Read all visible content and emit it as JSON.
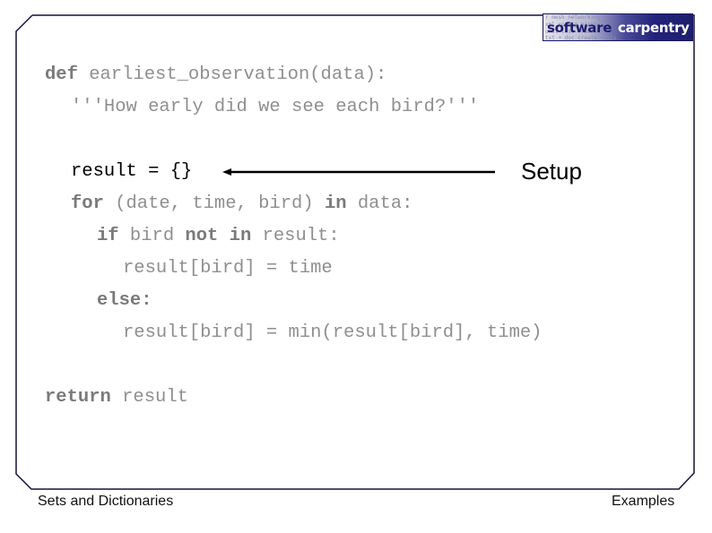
{
  "slide": {
    "logo": {
      "word1": "software",
      "word2": "carpentry",
      "faint_lines": [
        "r mesh networking",
        "xml config parser",
        "unit test framework",
        "txt + doc create tests"
      ]
    },
    "code_lines": [
      {
        "indent": 0,
        "parts": [
          {
            "t": "def",
            "kw": true
          },
          {
            "t": " earliest_observation(data):"
          }
        ]
      },
      {
        "indent": 1,
        "parts": [
          {
            "t": "'''How early did we see each bird?'''"
          }
        ]
      },
      {
        "indent": 1,
        "highlight": true,
        "parts": [
          {
            "t": "result = {}"
          }
        ]
      },
      {
        "indent": 1,
        "parts": [
          {
            "t": "for",
            "kw": true
          },
          {
            "t": " (date, time, bird) "
          },
          {
            "t": "in",
            "kw": true
          },
          {
            "t": " data:"
          }
        ]
      },
      {
        "indent": 2,
        "parts": [
          {
            "t": "if",
            "kw": true
          },
          {
            "t": " bird "
          },
          {
            "t": "not",
            "kw": true
          },
          {
            "t": " "
          },
          {
            "t": "in",
            "kw": true
          },
          {
            "t": " result:"
          }
        ]
      },
      {
        "indent": 3,
        "parts": [
          {
            "t": "result[bird] = time"
          }
        ]
      },
      {
        "indent": 2,
        "parts": [
          {
            "t": "else:",
            "kw": true
          }
        ]
      },
      {
        "indent": 3,
        "parts": [
          {
            "t": "result[bird] = min(result[bird], time)"
          }
        ]
      },
      {
        "indent": 0,
        "parts": [
          {
            "t": "return",
            "kw": true
          },
          {
            "t": " result"
          }
        ]
      }
    ],
    "annotation": "Setup",
    "footer_left": "Sets and Dictionaries",
    "footer_right": "Examples"
  },
  "colors": {
    "frame": "#1a0f3c",
    "code_dim": "#8f8f8f",
    "code_highlight": "#000000",
    "logo_dark": "#1e1e70"
  }
}
